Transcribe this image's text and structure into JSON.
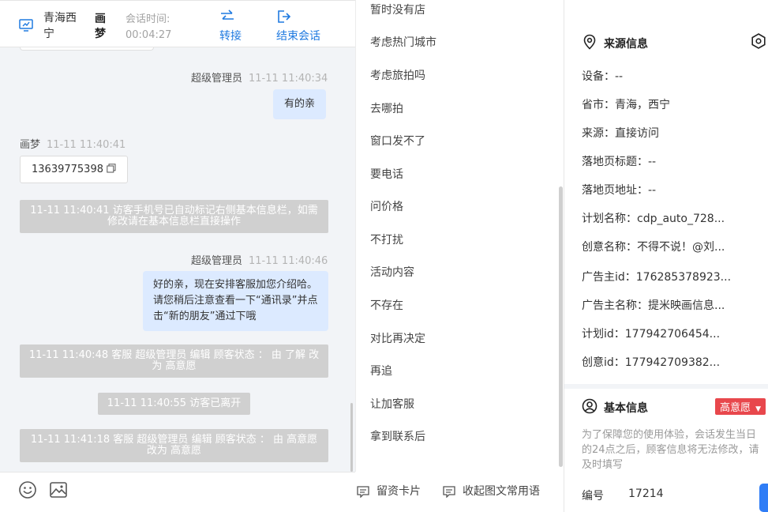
{
  "header": {
    "location": "青海西宁",
    "name": "画梦",
    "time_label": "会话时间:",
    "time_value": "00:04:27",
    "transfer_label": "转接",
    "end_label": "结束会话"
  },
  "chat": {
    "m1_sender": "超级管理员",
    "m1_time": "11-11 11:40:34",
    "m1_text": "有的亲",
    "m2_sender": "画梦",
    "m2_time": "11-11 11:40:41",
    "m2_text": "13639775398",
    "sys1": "11-11 11:40:41 访客手机号已自动标记右侧基本信息栏，如需修改请在基本信息栏直接操作",
    "m3_sender": "超级管理员",
    "m3_time": "11-11 11:40:46",
    "m3_text": "好的亲，现在安排客服加您介绍哈。请您稍后注意查看一下“通讯录”并点击“新的朋友”通过下哦",
    "sys2": "11-11 11:40:48 客服 超级管理员 编辑 顾客状态 ： 由 了解 改为 高意愿",
    "sys3": "11-11 11:40:55 访客已离开",
    "sys4": "11-11 11:41:18 客服 超级管理员 编辑 顾客状态 ： 由 高意愿 改为 高意愿"
  },
  "input_bar": {
    "emoji_icon": "smile-icon",
    "image_icon": "image-icon"
  },
  "phrases": {
    "items": [
      "暂时没有店",
      "考虑热门城市",
      "考虑旅拍吗",
      "去哪拍",
      "窗口发不了",
      "要电话",
      "问价格",
      "不打扰",
      "活动内容",
      "不存在",
      "对比再决定",
      "再追",
      "让加客服",
      "拿到联系后"
    ],
    "footer_card": "留资卡片",
    "footer_collect": "收起图文常用语"
  },
  "source_info": {
    "title": "来源信息",
    "device": "设备：--",
    "province": "省市：青海，西宁",
    "source": "来源：直接访问",
    "landing_title": "落地页标题：--",
    "landing_url": "落地页地址：--",
    "plan_name": "计划名称：cdp_auto_728...",
    "creative_name": "创意名称：不得不说！@刘...",
    "advertiser_id": "广告主id：176285378923...",
    "advertiser_name": "广告主名称：提米映画信息...",
    "plan_id": "计划id：177942706454...",
    "creative_id": "创意id：177942709382..."
  },
  "basic_info": {
    "title": "基本信息",
    "intent": "高意愿",
    "note": "为了保障您的使用体验，会话发生当日的24点之后，顾客信息将无法修改，请及时填写",
    "number_label": "编号",
    "number_value": "17214"
  },
  "colors": {
    "accent": "#1f7ae0",
    "agent_bubble": "#dceaff",
    "system": "#d0d0d0",
    "badge": "#e8474c"
  }
}
